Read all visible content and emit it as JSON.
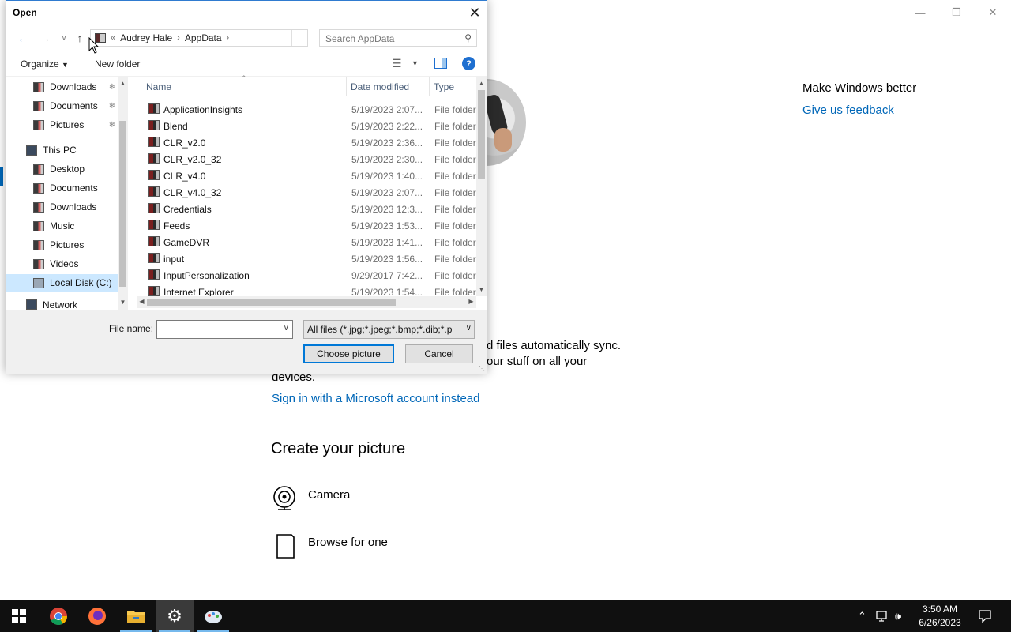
{
  "settings": {
    "make_better": "Make Windows better",
    "feedback_link": "Give us feedback",
    "ms_text_line1_tail": "d files automatically sync.",
    "ms_text_line2_tail": "our stuff on all your",
    "ms_text_line3": "devices.",
    "signin_link": "Sign in with a Microsoft account instead",
    "create_title": "Create your picture",
    "options": [
      {
        "label": "Camera",
        "icon": "camera-icon"
      },
      {
        "label": "Browse for one",
        "icon": "browse-file-icon"
      }
    ]
  },
  "dialog": {
    "title": "Open",
    "breadcrumb": {
      "prefix": "«",
      "segments": [
        "Audrey Hale",
        "AppData"
      ]
    },
    "search_placeholder": "Search AppData",
    "toolbar": {
      "organize": "Organize",
      "new_folder": "New folder"
    },
    "nav_items": [
      {
        "label": "Downloads",
        "pinned": true
      },
      {
        "label": "Documents",
        "pinned": true
      },
      {
        "label": "Pictures",
        "pinned": true
      },
      {
        "label": "This PC",
        "pinned": false
      },
      {
        "label": "Desktop",
        "pinned": false
      },
      {
        "label": "Documents",
        "pinned": false
      },
      {
        "label": "Downloads",
        "pinned": false
      },
      {
        "label": "Music",
        "pinned": false
      },
      {
        "label": "Pictures",
        "pinned": false
      },
      {
        "label": "Videos",
        "pinned": false
      },
      {
        "label": "Local Disk (C:)",
        "pinned": false,
        "selected": true
      },
      {
        "label": "Network",
        "pinned": false
      }
    ],
    "columns": {
      "name": "Name",
      "date": "Date modified",
      "type": "Type"
    },
    "rows": [
      {
        "name": "ApplicationInsights",
        "date": "5/19/2023 2:07...",
        "type": "File folder"
      },
      {
        "name": "Blend",
        "date": "5/19/2023 2:22...",
        "type": "File folder"
      },
      {
        "name": "CLR_v2.0",
        "date": "5/19/2023 2:36...",
        "type": "File folder"
      },
      {
        "name": "CLR_v2.0_32",
        "date": "5/19/2023 2:30...",
        "type": "File folder"
      },
      {
        "name": "CLR_v4.0",
        "date": "5/19/2023 1:40...",
        "type": "File folder"
      },
      {
        "name": "CLR_v4.0_32",
        "date": "5/19/2023 2:07...",
        "type": "File folder"
      },
      {
        "name": "Credentials",
        "date": "5/19/2023 12:3...",
        "type": "File folder"
      },
      {
        "name": "Feeds",
        "date": "5/19/2023 1:53...",
        "type": "File folder"
      },
      {
        "name": "GameDVR",
        "date": "5/19/2023 1:41...",
        "type": "File folder"
      },
      {
        "name": "input",
        "date": "5/19/2023 1:56...",
        "type": "File folder"
      },
      {
        "name": "InputPersonalization",
        "date": "9/29/2017 7:42...",
        "type": "File folder"
      },
      {
        "name": "Internet Explorer",
        "date": "5/19/2023 1:54...",
        "type": "File folder"
      }
    ],
    "file_name_label": "File name:",
    "file_name_value": "",
    "filter": "All files (*.jpg;*.jpeg;*.bmp;*.dib;*.p",
    "choose_button": "Choose picture",
    "cancel_button": "Cancel"
  },
  "taskbar": {
    "apps": [
      "start-icon",
      "chrome-icon",
      "firefox-icon",
      "file-explorer-icon",
      "settings-icon",
      "paint-icon"
    ],
    "time": "3:50 AM",
    "date": "6/26/2023"
  },
  "colors": {
    "accent": "#0067b8",
    "dialog_border": "#2f7bd0",
    "taskbar": "#101010",
    "selected_nav": "#cce8ff"
  }
}
